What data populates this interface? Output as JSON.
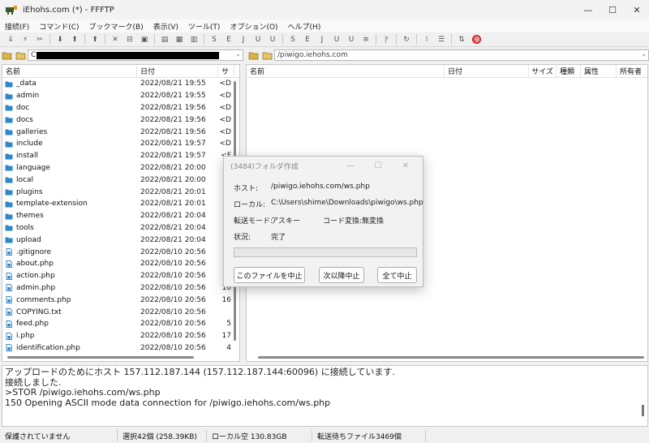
{
  "window": {
    "title": "iEhohs.com (*) - FFFTP",
    "controls": [
      "—",
      "☐",
      "✕"
    ]
  },
  "menu": [
    "接続(F)",
    "コマンド(C)",
    "ブックマーク(B)",
    "表示(V)",
    "ツール(T)",
    "オプション(O)",
    "ヘルプ(H)"
  ],
  "toolbar": {
    "icons": [
      "connect-icon",
      "quick-connect-icon",
      "disconnect-icon",
      "download-icon",
      "upload-icon",
      "up-dir-icon",
      "delete-icon",
      "rename-icon",
      "mkdir-icon",
      "view-icon",
      "s-icon",
      "e-icon",
      "j-icon",
      "u-icon",
      "s2-icon",
      "e2-icon",
      "j2-icon",
      "u2-icon",
      "list-icon",
      "kanji-icon",
      "refresh-icon",
      "list-view-icon",
      "detail-view-icon",
      "sync-icon",
      "stop-icon"
    ]
  },
  "local": {
    "path": "C",
    "columns": [
      "名前",
      "日付",
      "サ"
    ],
    "files": [
      {
        "name": "_data",
        "date": "2022/08/21 19:55",
        "size": "<D",
        "type": "folder"
      },
      {
        "name": "admin",
        "date": "2022/08/21 19:55",
        "size": "<D",
        "type": "folder"
      },
      {
        "name": "doc",
        "date": "2022/08/21 19:56",
        "size": "<D",
        "type": "folder"
      },
      {
        "name": "docs",
        "date": "2022/08/21 19:56",
        "size": "<D",
        "type": "folder"
      },
      {
        "name": "galleries",
        "date": "2022/08/21 19:56",
        "size": "<D",
        "type": "folder"
      },
      {
        "name": "include",
        "date": "2022/08/21 19:57",
        "size": "<D",
        "type": "folder"
      },
      {
        "name": "install",
        "date": "2022/08/21 19:57",
        "size": "<F",
        "type": "folder"
      },
      {
        "name": "language",
        "date": "2022/08/21 20:00",
        "size": "<",
        "type": "folder"
      },
      {
        "name": "local",
        "date": "2022/08/21 20:00",
        "size": "<",
        "type": "folder"
      },
      {
        "name": "plugins",
        "date": "2022/08/21 20:01",
        "size": "<",
        "type": "folder"
      },
      {
        "name": "template-extension",
        "date": "2022/08/21 20:01",
        "size": "<",
        "type": "folder"
      },
      {
        "name": "themes",
        "date": "2022/08/21 20:04",
        "size": "<",
        "type": "folder"
      },
      {
        "name": "tools",
        "date": "2022/08/21 20:04",
        "size": "<",
        "type": "folder"
      },
      {
        "name": "upload",
        "date": "2022/08/21 20:04",
        "size": "<",
        "type": "folder"
      },
      {
        "name": ".gitignore",
        "date": "2022/08/10 20:56",
        "size": "",
        "type": "file"
      },
      {
        "name": "about.php",
        "date": "2022/08/10 20:56",
        "size": "",
        "type": "file"
      },
      {
        "name": "action.php",
        "date": "2022/08/10 20:56",
        "size": "",
        "type": "file"
      },
      {
        "name": "admin.php",
        "date": "2022/08/10 20:56",
        "size": "10",
        "type": "file"
      },
      {
        "name": "comments.php",
        "date": "2022/08/10 20:56",
        "size": "16",
        "type": "file"
      },
      {
        "name": "COPYING.txt",
        "date": "2022/08/10 20:56",
        "size": "",
        "type": "file"
      },
      {
        "name": "feed.php",
        "date": "2022/08/10 20:56",
        "size": "5",
        "type": "file"
      },
      {
        "name": "i.php",
        "date": "2022/08/10 20:56",
        "size": "17",
        "type": "file"
      },
      {
        "name": "identification.php",
        "date": "2022/08/10 20:56",
        "size": "4",
        "type": "file"
      }
    ]
  },
  "remote": {
    "path": "/piwigo.iehohs.com",
    "columns": [
      "名前",
      "日付",
      "サイズ",
      "種類",
      "属性",
      "所有者"
    ]
  },
  "dialog": {
    "title": "(3484)フォルダ作成",
    "host_label": "ホスト:",
    "host_value": "/piwigo.iehohs.com/ws.php",
    "local_label": "ローカル:",
    "local_value": "C:\\Users\\shime\\Downloads\\piwigo\\ws.php",
    "mode_label": "転送モード:",
    "mode_value": "アスキー",
    "code_label": "コード変換:",
    "code_value": "無変換",
    "status_label": "状況:",
    "status_value": "完了",
    "progress": 0,
    "buttons": [
      "このファイルを中止",
      "次以降中止",
      "全て中止"
    ]
  },
  "log": [
    "アップロードのためにホスト 157.112.187.144 (157.112.187.144:60096) に接続しています.",
    "接続しました.",
    ">STOR /piwigo.iehohs.com/ws.php",
    "150 Opening ASCII mode data connection for /piwigo.iehohs.com/ws.php"
  ],
  "status": {
    "save": "保護されていません",
    "selection": "選択42個 (258.39KB)",
    "local_free": "ローカル空 130.83GB",
    "queue": "転送待ちファイル3469個"
  },
  "colors": {
    "folder": "#2f87c9",
    "file": "#2f87c9",
    "stop": "#d61f1f",
    "progress": "#06b025"
  }
}
